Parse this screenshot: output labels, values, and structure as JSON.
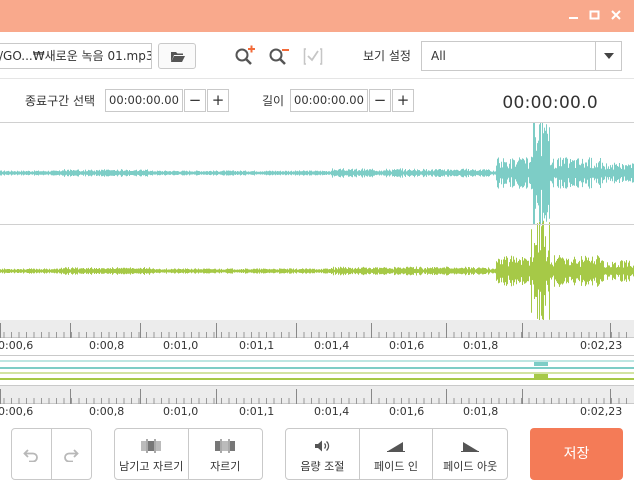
{
  "window": {
    "minimize_icon": "minimize-icon",
    "maximize_icon": "maximize-icon",
    "close_icon": "close-icon",
    "titlebar_color": "#f9a98c"
  },
  "toolbar": {
    "file_path": "/GO...₩새로운 녹음 01.mp3",
    "open_folder_icon": "folder-open-icon",
    "zoom_in_icon": "zoom-in-icon",
    "zoom_out_icon": "zoom-out-icon",
    "select_all_icon": "checkbox-icon",
    "view_settings_label": "보기 설정",
    "view_settings_value": "All"
  },
  "time": {
    "end_section_label": "종료구간 선택",
    "end_section_value": "00:00:00.00",
    "length_label": "길이",
    "length_value": "00:00:00.00",
    "minus": "−",
    "plus": "+",
    "current_time": "00:00:00.0"
  },
  "waveform": {
    "top_channel_color": "#7dcdc6",
    "bottom_channel_color": "#a6c947"
  },
  "ruler_top": {
    "ticks": [
      "0:00,6",
      "0:00,8",
      "0:01,0",
      "0:01,1",
      "0:01,4",
      "0:01,6",
      "0:01,8",
      "0:02,23"
    ]
  },
  "ruler_bottom": {
    "ticks": [
      "0:00,6",
      "0:00,8",
      "0:01,0",
      "0:01,1",
      "0:01,4",
      "0:01,6",
      "0:01,8",
      "0:02,23"
    ]
  },
  "actions": {
    "undo_icon": "undo-icon",
    "redo_icon": "redo-icon",
    "trim_keep_label": "남기고 자르기",
    "cut_label": "자르기",
    "volume_label": "음량 조절",
    "fade_in_label": "페이드 인",
    "fade_out_label": "페이드 아웃",
    "save_label": "저장",
    "accent_color": "#f47b57"
  }
}
